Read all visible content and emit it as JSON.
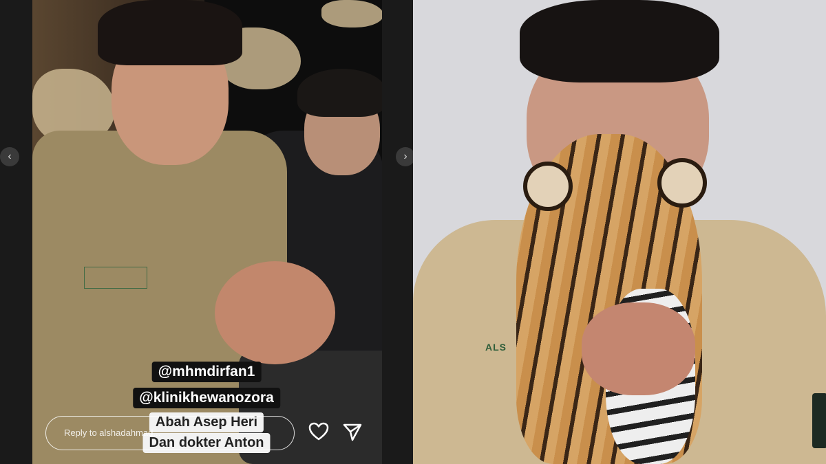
{
  "story": {
    "mentions": [
      "@mhmdirfan1",
      "@klinikhewanozora"
    ],
    "caption_lines": [
      "Abah Asep Heri",
      "Dan dokter Anton"
    ],
    "reply_placeholder": "Reply to alshadahmad...",
    "shirt_patch_text": "",
    "icons": {
      "prev": "chevron-left-icon",
      "next": "chevron-right-icon",
      "like": "heart-icon",
      "share": "send-icon"
    }
  },
  "photo": {
    "shirt_text": "ALS"
  },
  "colors": {
    "tag_bg": "#111111",
    "tag_text": "#ffffff",
    "caption_bg": "#f2f2f2",
    "caption_text": "#222222"
  }
}
